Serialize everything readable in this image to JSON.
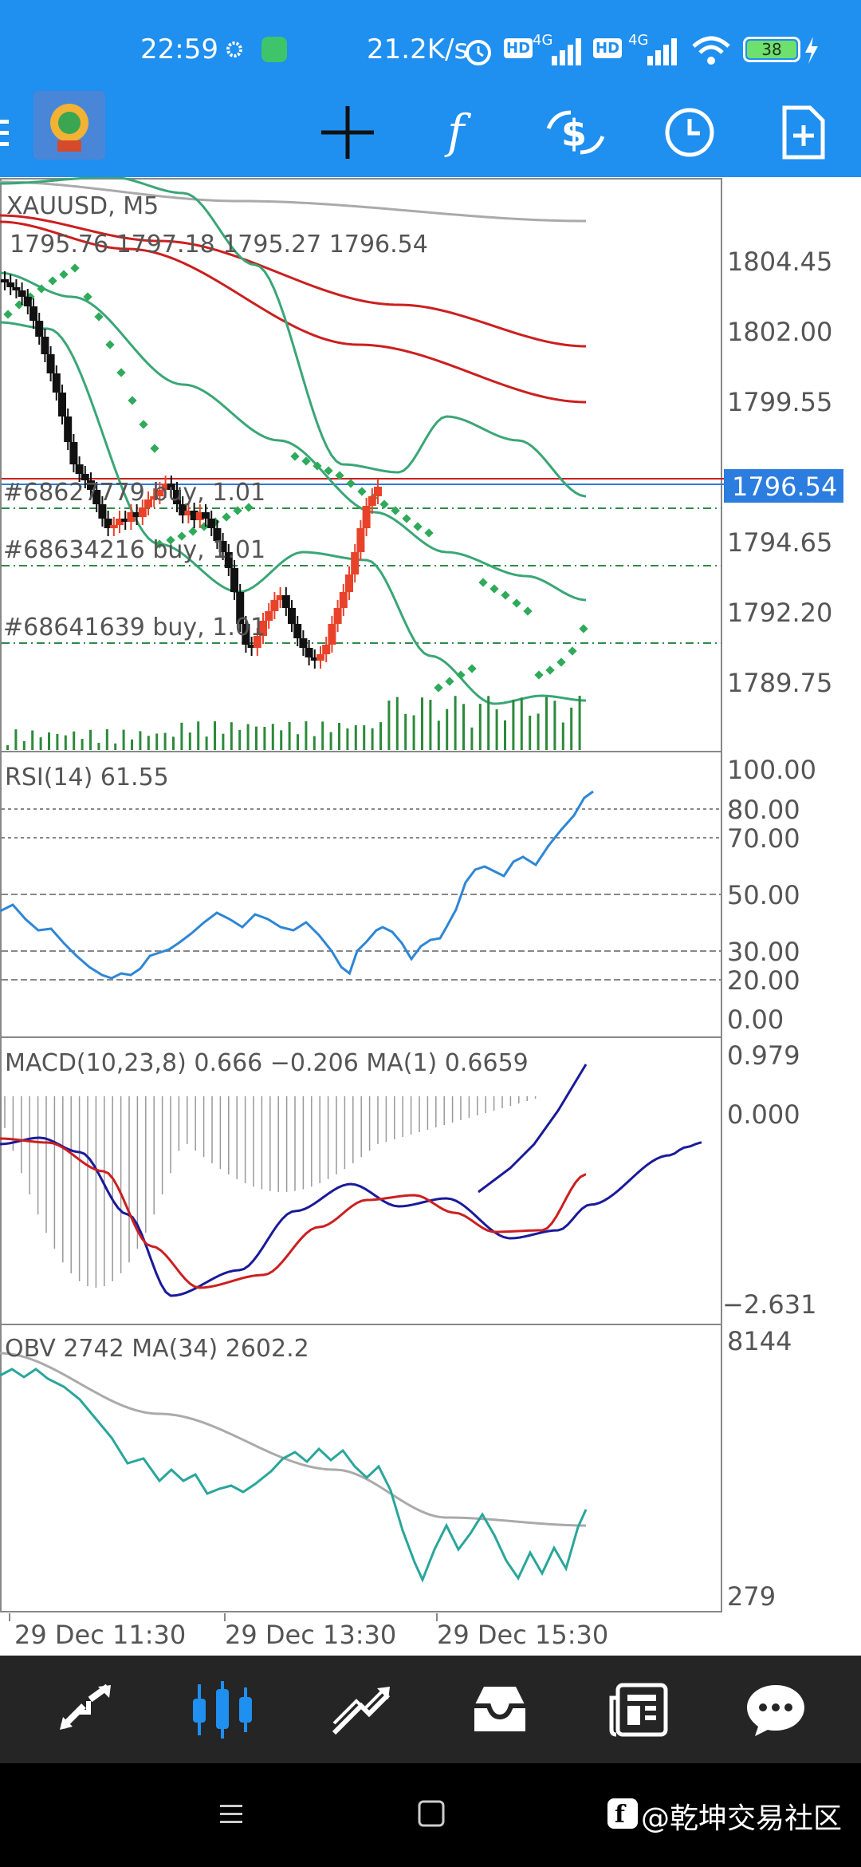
{
  "status_bar": {
    "time": "22:59",
    "net_speed": "21.2K/s",
    "hd1": "HD",
    "net1": "4G",
    "hd2": "HD",
    "net2": "4G",
    "battery": "38"
  },
  "toolbar": {
    "icons": [
      "menu-icon",
      "metatrader-logo",
      "crosshair-icon",
      "indicators-icon",
      "trade-icon",
      "timeframe-icon",
      "new-order-icon"
    ]
  },
  "main_chart": {
    "symbol_label": "XAUUSD, M5",
    "ohlc": "1795.76 1797.18 1795.27 1796.54",
    "current_price": "1796.54",
    "price_ticks": [
      "1804.45",
      "1802.00",
      "1799.55",
      "1794.65",
      "1792.20",
      "1789.75"
    ],
    "orders": [
      "#68627779 buy, 1.01",
      "#68634216 buy, 1.01",
      "#68641639 buy, 1.01"
    ]
  },
  "rsi": {
    "label": "RSI(14) 61.55",
    "ticks": [
      "100.00",
      "80.00",
      "70.00",
      "50.00",
      "30.00",
      "20.00",
      "0.00"
    ]
  },
  "macd": {
    "label": "MACD(10,23,8) 0.666 −0.206 MA(1) 0.6659",
    "ticks": [
      "0.979",
      "0.000",
      "−2.631"
    ]
  },
  "obv": {
    "label": "OBV 2742 MA(34) 2602.2",
    "ticks": [
      "8144",
      "279"
    ]
  },
  "time_axis": [
    "29 Dec 11:30",
    "29 Dec 13:30",
    "29 Dec 15:30"
  ],
  "bottom_nav": [
    "quotes-icon",
    "chart-icon",
    "trade-icon",
    "history-icon",
    "news-icon",
    "messages-icon"
  ],
  "watermark": "@乾坤交易社区",
  "colors": {
    "header": "#1f8ff0",
    "bull": "#e8432a",
    "bear": "#111111",
    "ma_red": "#cc1f1f",
    "bands": "#3aa676",
    "sar": "#2faa5a",
    "rsi_line": "#2e86d6",
    "macd_main": "#1a1a9a",
    "macd_signal": "#cc1f1f",
    "obv_line": "#29a69b",
    "obv_ma": "#aaaaaa",
    "price_tag": "#2b7de0"
  }
}
